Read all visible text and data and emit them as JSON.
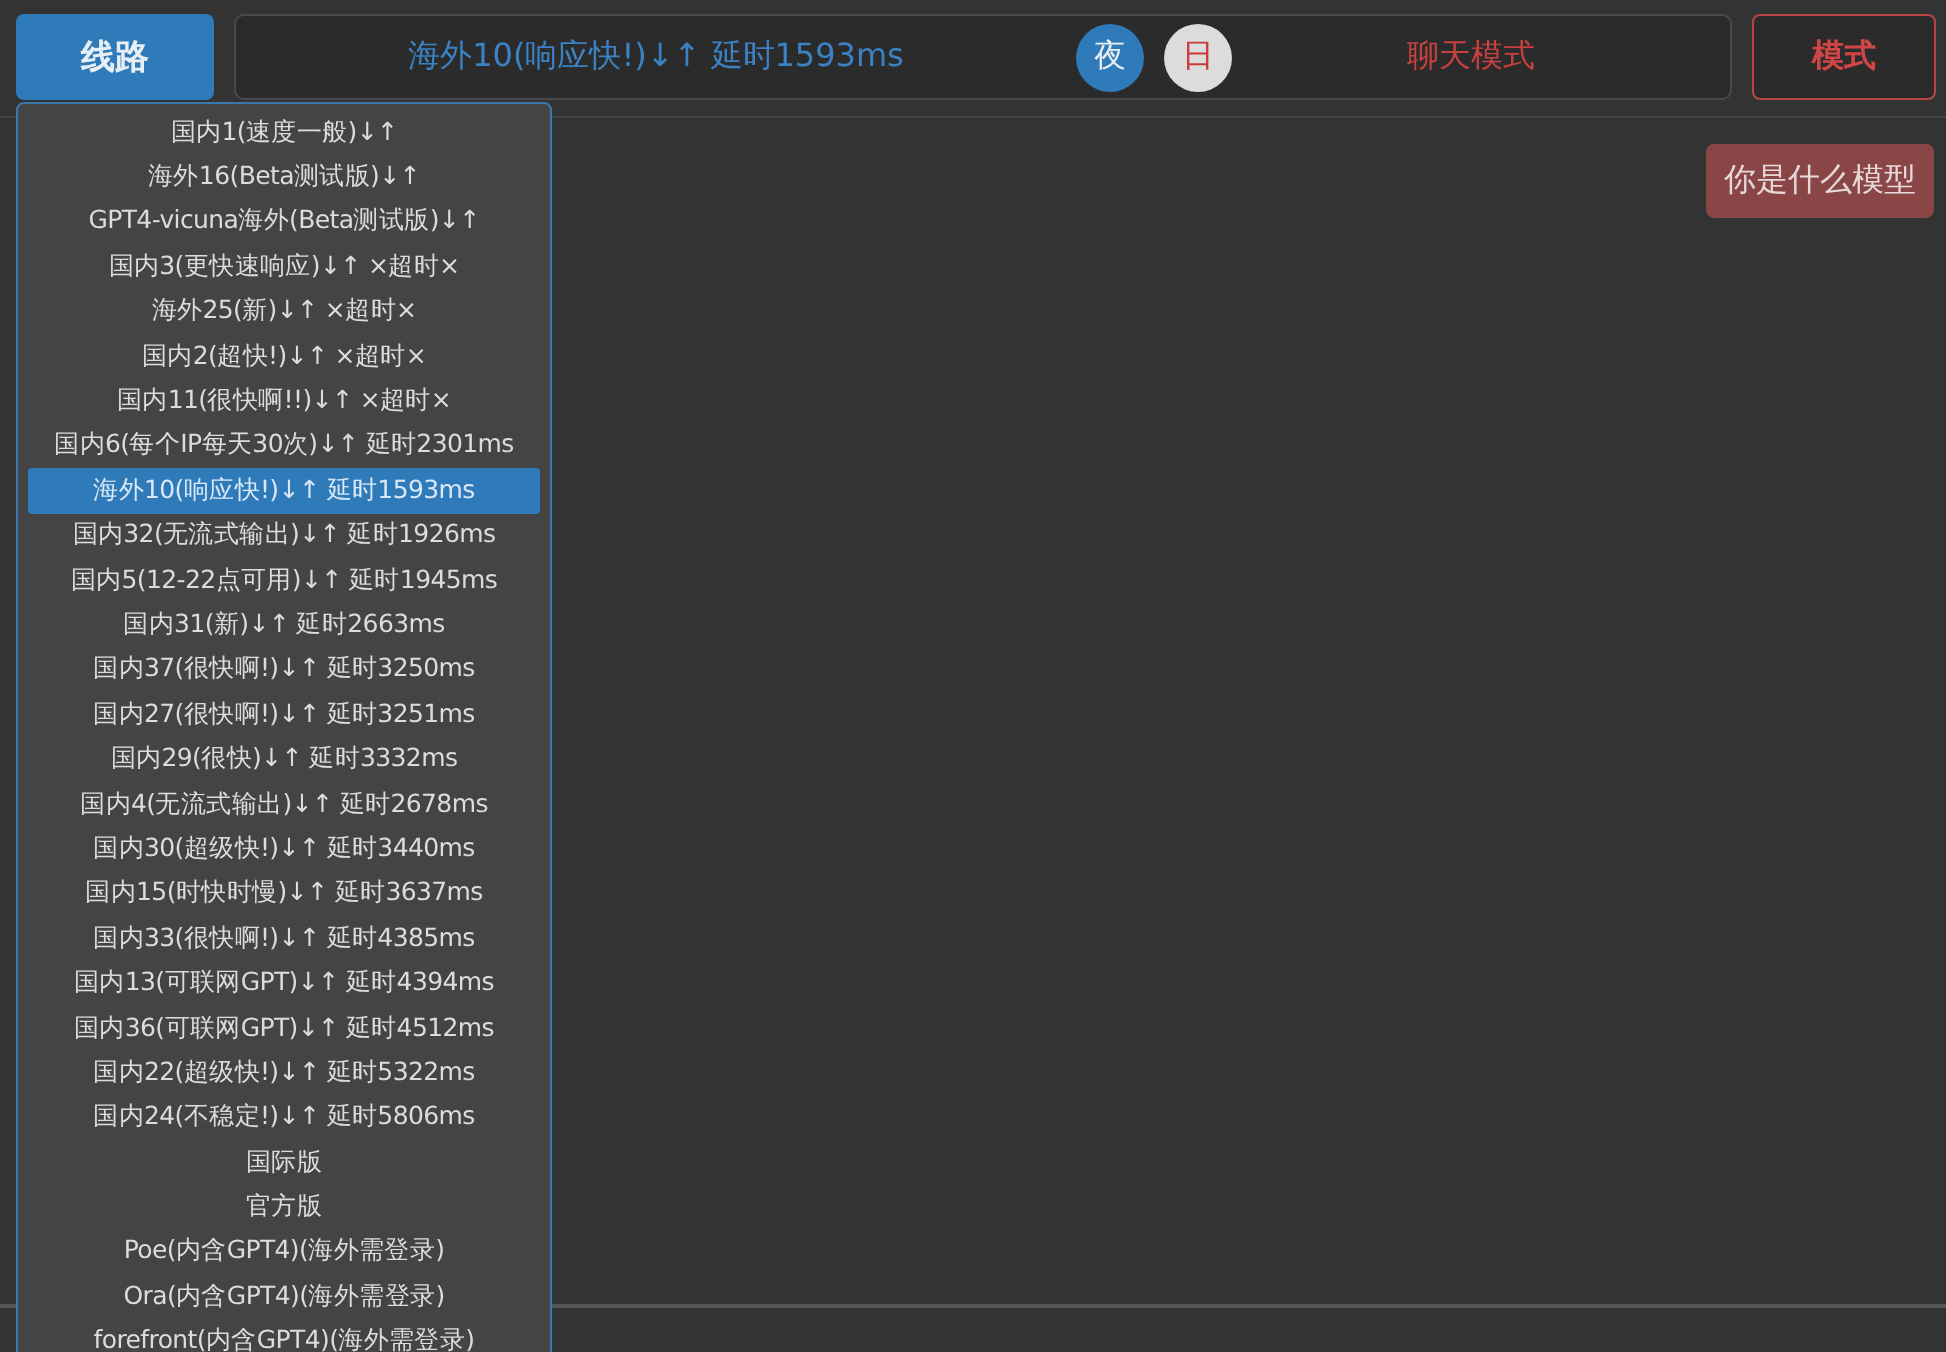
{
  "route_button": {
    "label": "线路",
    "open": true
  },
  "status": {
    "route": "海外10(响应快!)↓↑ 延时1593ms",
    "mode": "聊天模式"
  },
  "theme_buttons": [
    {
      "label": "夜",
      "selected": true
    },
    {
      "label": "日",
      "selected": false
    }
  ],
  "mode_button": {
    "label": "模式"
  },
  "route_menu": [
    {
      "label": "国内1(速度一般)↓↑",
      "selected": false
    },
    {
      "label": "海外16(Beta测试版)↓↑",
      "selected": false
    },
    {
      "label": "GPT4-vicuna海外(Beta测试版)↓↑",
      "selected": false
    },
    {
      "label": "国内3(更快速响应)↓↑ ×超时×",
      "selected": false
    },
    {
      "label": "海外25(新)↓↑ ×超时×",
      "selected": false
    },
    {
      "label": "国内2(超快!)↓↑ ×超时×",
      "selected": false
    },
    {
      "label": "国内11(很快啊!!)↓↑ ×超时×",
      "selected": false
    },
    {
      "label": "国内6(每个IP每天30次)↓↑ 延时2301ms",
      "selected": false
    },
    {
      "label": "海外10(响应快!)↓↑ 延时1593ms",
      "selected": true
    },
    {
      "label": "国内32(无流式输出)↓↑ 延时1926ms",
      "selected": false
    },
    {
      "label": "国内5(12-22点可用)↓↑ 延时1945ms",
      "selected": false
    },
    {
      "label": "国内31(新)↓↑ 延时2663ms",
      "selected": false
    },
    {
      "label": "国内37(很快啊!)↓↑ 延时3250ms",
      "selected": false
    },
    {
      "label": "国内27(很快啊!)↓↑ 延时3251ms",
      "selected": false
    },
    {
      "label": "国内29(很快)↓↑ 延时3332ms",
      "selected": false
    },
    {
      "label": "国内4(无流式输出)↓↑ 延时2678ms",
      "selected": false
    },
    {
      "label": "国内30(超级快!)↓↑ 延时3440ms",
      "selected": false
    },
    {
      "label": "国内15(时快时慢)↓↑ 延时3637ms",
      "selected": false
    },
    {
      "label": "国内33(很快啊!)↓↑ 延时4385ms",
      "selected": false
    },
    {
      "label": "国内13(可联网GPT)↓↑ 延时4394ms",
      "selected": false
    },
    {
      "label": "国内36(可联网GPT)↓↑ 延时4512ms",
      "selected": false
    },
    {
      "label": "国内22(超级快!)↓↑ 延时5322ms",
      "selected": false
    },
    {
      "label": "国内24(不稳定!)↓↑ 延时5806ms",
      "selected": false
    },
    {
      "label": "国际版",
      "selected": false
    },
    {
      "label": "官方版",
      "selected": false
    },
    {
      "label": "Poe(内含GPT4)(海外需登录)",
      "selected": false
    },
    {
      "label": "Ora(内含GPT4)(海外需登录)",
      "selected": false
    },
    {
      "label": "forefront(内含GPT4)(海外需登录)",
      "selected": false
    }
  ],
  "messages": [
    {
      "kind": "outgoing",
      "text": "你是什么模型"
    }
  ]
}
